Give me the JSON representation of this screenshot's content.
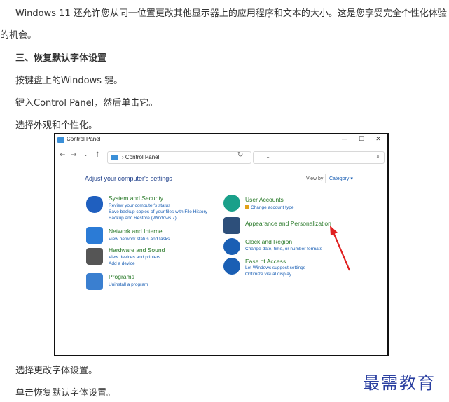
{
  "article": {
    "p1_line1": "Windows 11 还允许您从同一位置更改其他显示器上的应用程序和文本的大小。这是您享受完全个性化体验",
    "p1_line2": "的机会。",
    "heading3": "三、恢复默认字体设置",
    "step1": "按键盘上的Windows 键。",
    "step2": "键入Control Panel，然后单击它。",
    "step3": "选择外观和个性化。",
    "step4": "选择更改字体设置。",
    "step5": "单击恢复默认字体设置。"
  },
  "screenshot": {
    "window_title": "Control Panel",
    "window_buttons": [
      "—",
      "☐",
      "✕"
    ],
    "address_path": "Control Panel",
    "address_sep": "›",
    "nav_back": "←",
    "nav_forward": "→",
    "nav_recent": "⌄",
    "nav_up": "↑",
    "dropdown_chevron": "⌄",
    "refresh": "↻",
    "search_icon": "⌕",
    "heading": "Adjust your computer's settings",
    "view_by_label": "View by:",
    "view_by_value": "Category ▾",
    "categories": [
      {
        "title": "System and Security",
        "links": [
          "Review your computer's status",
          "Save backup copies of your files with File History",
          "Backup and Restore (Windows 7)"
        ],
        "color": "#1f5fbf"
      },
      {
        "title": "Network and Internet",
        "links": [
          "View network status and tasks"
        ],
        "color": "#2b7bd6"
      },
      {
        "title": "Hardware and Sound",
        "links": [
          "View devices and printers",
          "Add a device"
        ],
        "color": "#555555"
      },
      {
        "title": "Programs",
        "links": [
          "Uninstall a program"
        ],
        "color": "#3a7fd0"
      },
      {
        "title": "User Accounts",
        "links": [
          "Change account type"
        ],
        "color": "#1aa08a"
      },
      {
        "title": "Appearance and Personalization",
        "links": [],
        "color": "#2d4f7a"
      },
      {
        "title": "Clock and Region",
        "links": [
          "Change date, time, or number formats"
        ],
        "color": "#1a5fb4"
      },
      {
        "title": "Ease of Access",
        "links": [
          "Let Windows suggest settings",
          "Optimize visual display"
        ],
        "color": "#1a5fb4"
      }
    ],
    "arrow_color": "#e02020"
  },
  "watermark": "最需教育"
}
